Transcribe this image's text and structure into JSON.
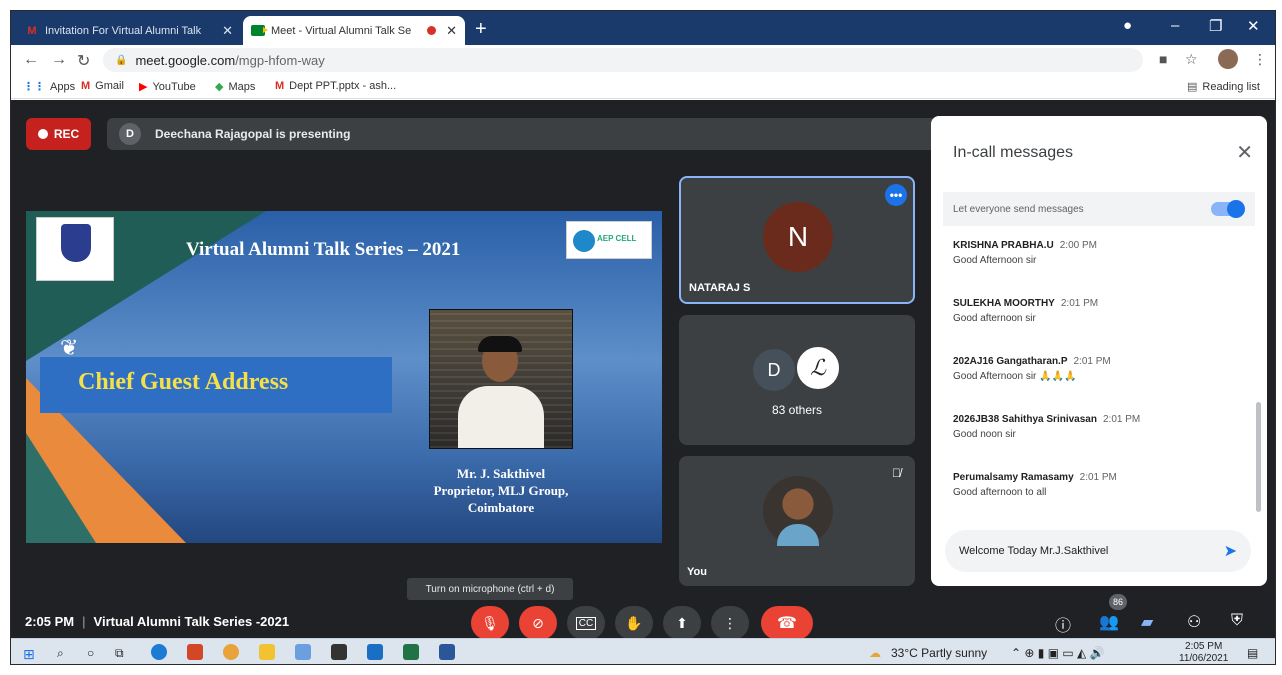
{
  "browser": {
    "tabs": [
      {
        "title": "Invitation For Virtual Alumni Talk",
        "favicon": "gmail-icon",
        "active": false
      },
      {
        "title": "Meet - Virtual Alumni Talk Se",
        "favicon": "meet-icon",
        "active": true
      }
    ],
    "url_host": "meet.google.com",
    "url_path": "/mgp-hfom-way",
    "bookmarks": [
      "Apps",
      "Gmail",
      "YouTube",
      "Maps",
      "Dept PPT.pptx - ash..."
    ],
    "reading_list": "Reading list"
  },
  "meet": {
    "rec_label": "REC",
    "presenter_initial": "D",
    "presenting_text": "Deechana Rajagopal is presenting",
    "slide": {
      "title": "Virtual Alumni Talk Series – 2021",
      "banner": "Chief Guest Address",
      "logo_text": "AEP CELL",
      "caption_line1": "Mr. J. Sakthivel",
      "caption_line2": "Proprietor, MLJ Group,",
      "caption_line3": "Coimbatore"
    },
    "tiles": [
      {
        "initial": "N",
        "name": "NATARAJ S",
        "avatar_color": "#6b2b1c"
      },
      {
        "initial": "D",
        "initial2": "ℒ",
        "label": "83 others"
      },
      {
        "name": "You"
      }
    ],
    "chat": {
      "title": "In-call messages",
      "toggle_label": "Let everyone send messages",
      "messages": [
        {
          "sender": "KRISHNA PRABHA.U",
          "time": "2:00 PM",
          "text": "Good Afternoon sir"
        },
        {
          "sender": "SULEKHA MOORTHY",
          "time": "2:01 PM",
          "text": "Good afternoon sir"
        },
        {
          "sender": "202AJ16 Gangatharan.P",
          "time": "2:01 PM",
          "text": "Good Afternoon sir 🙏🙏🙏"
        },
        {
          "sender": "2026JB38 Sahithya Srinivasan",
          "time": "2:01 PM",
          "text": "Good noon sir"
        },
        {
          "sender": "Perumalsamy Ramasamy",
          "time": "2:01 PM",
          "text": "Good afternoon to all"
        }
      ],
      "input_value": "Welcome Today Mr.J.Sakthivel"
    },
    "tooltip": "Turn on microphone (ctrl + d)",
    "time": "2:05 PM",
    "meeting_name": "Virtual Alumni Talk Series -2021",
    "participants_badge": "86"
  },
  "taskbar": {
    "weather": "33°C  Partly sunny",
    "time": "2:05 PM",
    "date": "11/06/2021"
  },
  "colors": {
    "meet_bg": "#202124",
    "rec_red": "#c5221f",
    "accent_blue": "#1a73e8",
    "end_call_red": "#ea4335"
  }
}
